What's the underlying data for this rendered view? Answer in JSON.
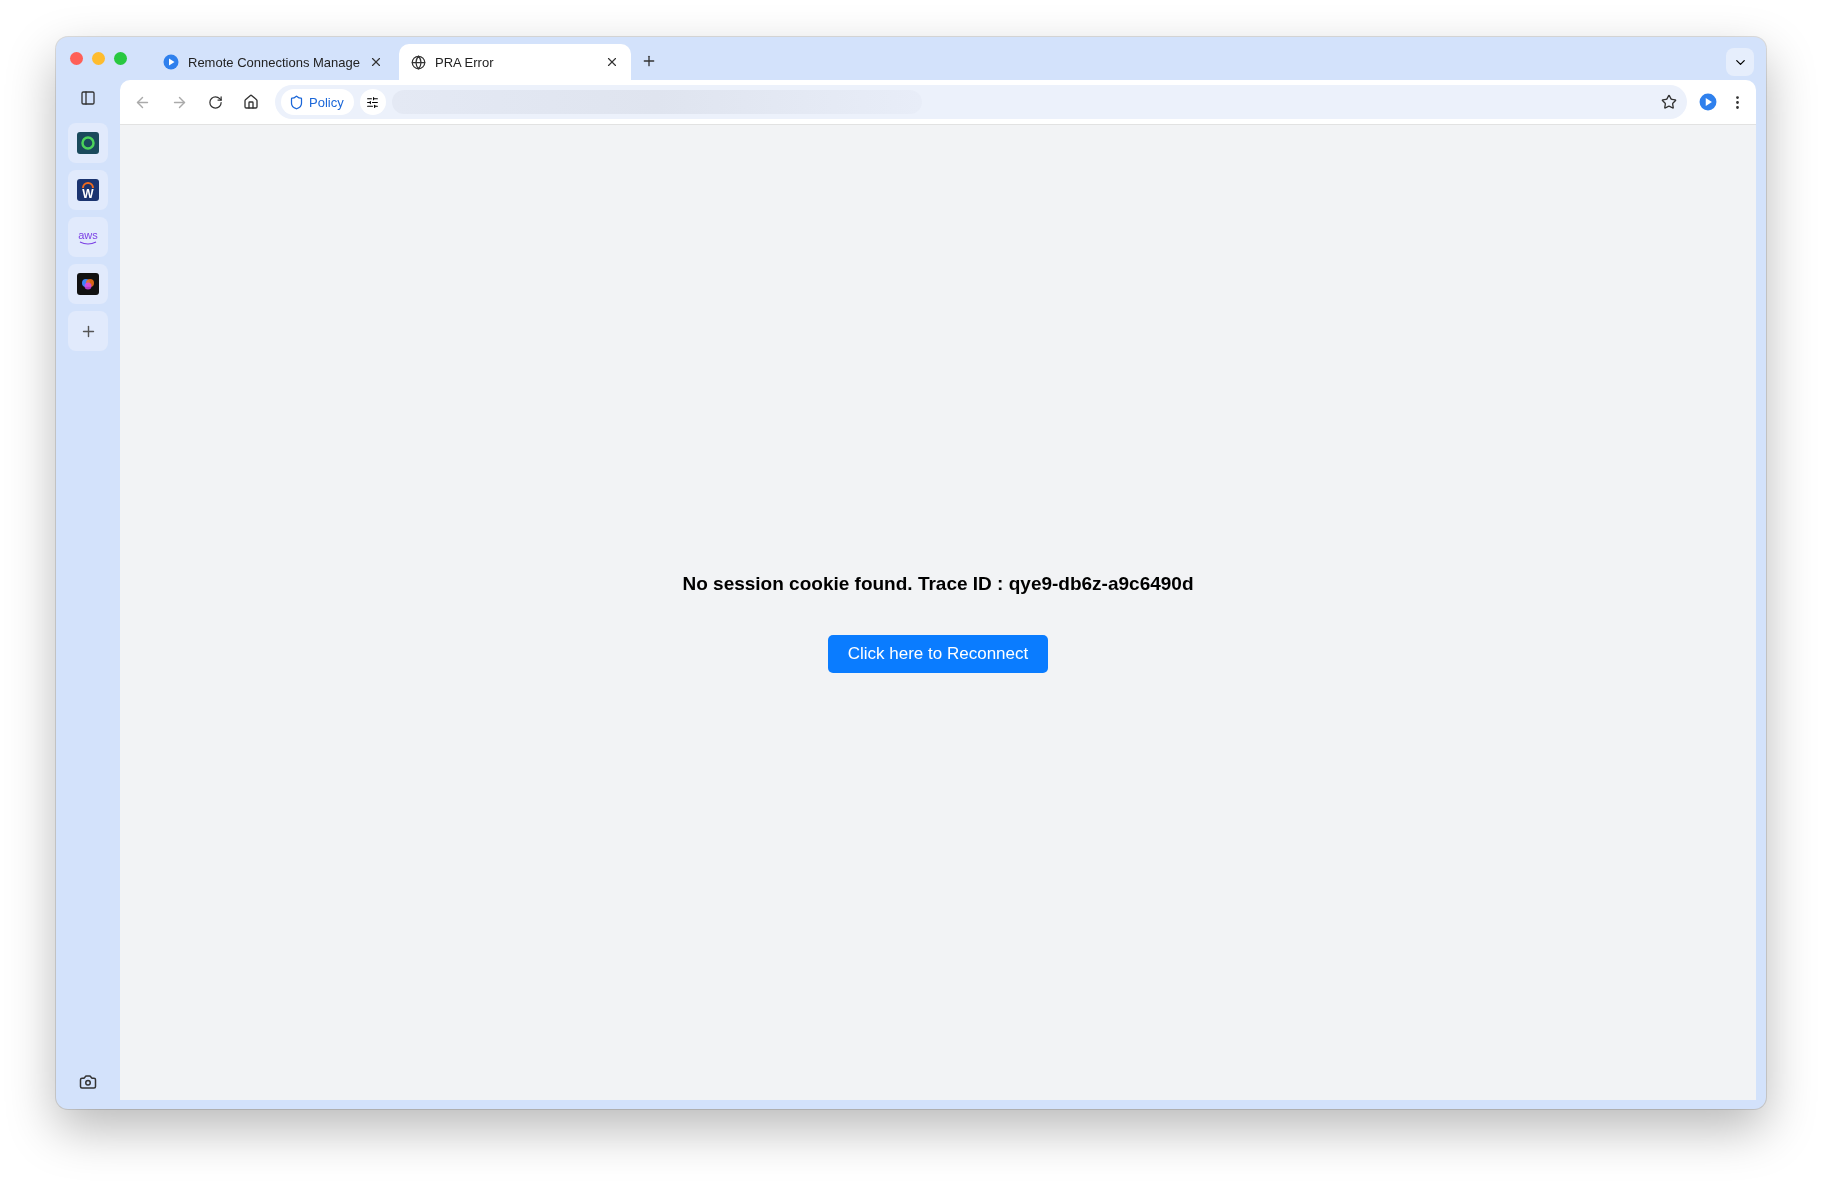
{
  "tabs": [
    {
      "title": "Remote Connections Manage",
      "selected": false,
      "kind": "app"
    },
    {
      "title": "PRA Error",
      "selected": true,
      "kind": "web"
    }
  ],
  "toolbar": {
    "policy_chip": "Policy"
  },
  "sidebar": {
    "apps": [
      {
        "kind": "ring"
      },
      {
        "kind": "letter",
        "label": "W"
      },
      {
        "kind": "wordmark",
        "label": "aws"
      },
      {
        "kind": "blob"
      }
    ]
  },
  "page": {
    "message": "No session cookie found. Trace ID : qye9-db6z-a9c6490d",
    "button": "Click here to Reconnect"
  }
}
